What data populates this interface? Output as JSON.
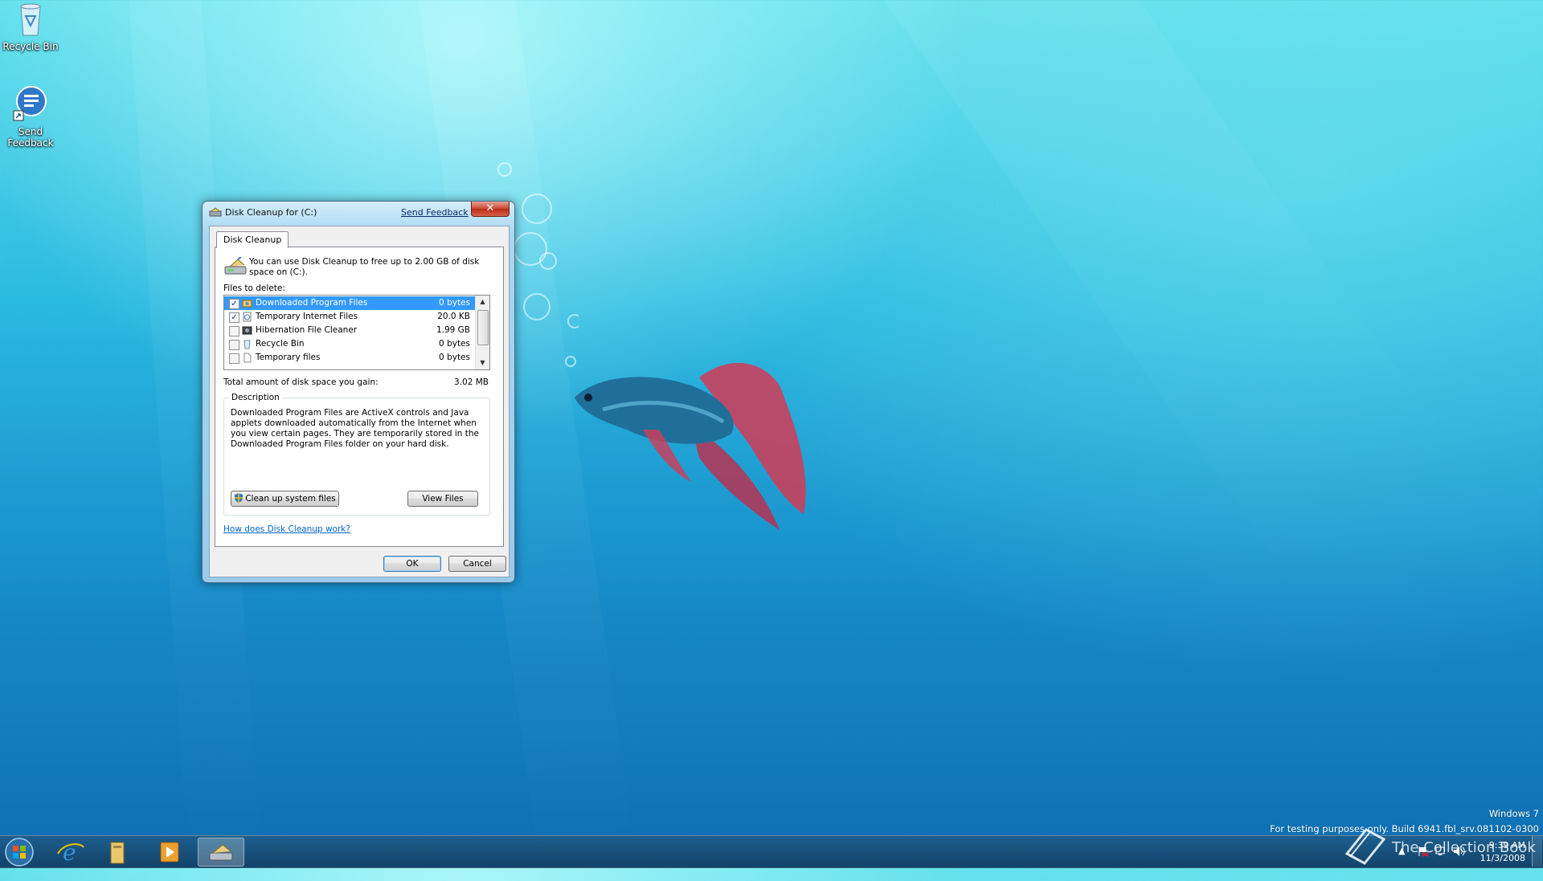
{
  "desktop": {
    "icons": [
      {
        "label": "Recycle Bin",
        "icon": "recycle-bin-icon"
      },
      {
        "label": "Send Feedback",
        "icon": "send-feedback-icon"
      }
    ],
    "watermark_line1": "Windows 7",
    "watermark_line2": "For testing purposes only. Build 6941.fbl_srv.081102-0300",
    "overlay_logo_text": "The Collection Book"
  },
  "dialog": {
    "title": "Disk Cleanup for  (C:)",
    "send_feedback": "Send Feedback",
    "close_glyph": "✕",
    "tab_label": "Disk Cleanup",
    "intro": "You can use Disk Cleanup to free up to 2.00 GB of disk space on  (C:).",
    "files_label": "Files to delete:",
    "files": [
      {
        "name": "Downloaded Program Files",
        "size": "0 bytes",
        "checked": true,
        "selected": true,
        "icon": "folder-gear-icon"
      },
      {
        "name": "Temporary Internet Files",
        "size": "20.0 KB",
        "checked": true,
        "selected": false,
        "icon": "internet-files-icon"
      },
      {
        "name": "Hibernation File Cleaner",
        "size": "1.99 GB",
        "checked": false,
        "selected": false,
        "icon": "hibernation-icon"
      },
      {
        "name": "Recycle Bin",
        "size": "0 bytes",
        "checked": false,
        "selected": false,
        "icon": "recycle-bin-icon"
      },
      {
        "name": "Temporary files",
        "size": "0 bytes",
        "checked": false,
        "selected": false,
        "icon": "blank-file-icon"
      }
    ],
    "total_label": "Total amount of disk space you gain:",
    "total_value": "3.02 MB",
    "description_legend": "Description",
    "description": "Downloaded Program Files are ActiveX controls and Java applets downloaded automatically from the Internet when you view certain pages. They are temporarily stored in the Downloaded Program Files folder on your hard disk.",
    "cleanup_system_label": "Clean up system files",
    "view_files_label": "View Files",
    "help_link": "How does Disk Cleanup work?",
    "ok_label": "OK",
    "cancel_label": "Cancel"
  },
  "taskbar": {
    "pinned": [
      "start-orb-icon",
      "internet-explorer-icon",
      "windows-explorer-icon",
      "media-player-icon",
      "disk-cleanup-icon"
    ],
    "clock_time": "9:39 AM",
    "clock_date": "11/3/2008"
  }
}
